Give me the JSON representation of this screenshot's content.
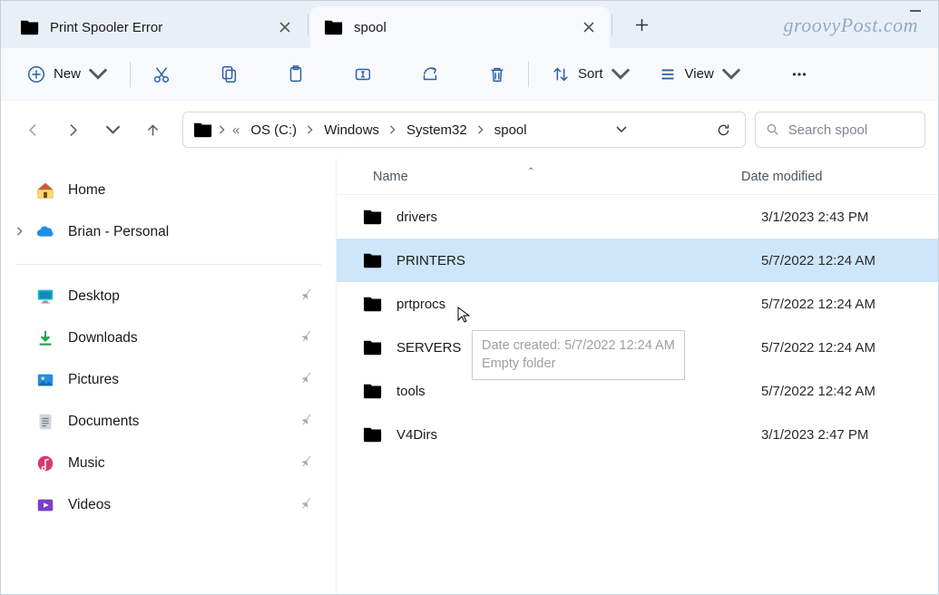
{
  "tabs": [
    {
      "label": "Print Spooler Error",
      "active": false
    },
    {
      "label": "spool",
      "active": true
    }
  ],
  "watermark": "groovyPost.com",
  "toolbar": {
    "new_label": "New",
    "sort_label": "Sort",
    "view_label": "View"
  },
  "breadcrumb": {
    "segments": [
      "OS (C:)",
      "Windows",
      "System32",
      "spool"
    ]
  },
  "search": {
    "placeholder": "Search spool"
  },
  "sidebar": {
    "home": "Home",
    "onedrive": "Brian - Personal",
    "quick": [
      {
        "label": "Desktop"
      },
      {
        "label": "Downloads"
      },
      {
        "label": "Pictures"
      },
      {
        "label": "Documents"
      },
      {
        "label": "Music"
      },
      {
        "label": "Videos"
      }
    ]
  },
  "columns": {
    "name": "Name",
    "date": "Date modified"
  },
  "files": [
    {
      "name": "drivers",
      "date": "3/1/2023 2:43 PM",
      "selected": false
    },
    {
      "name": "PRINTERS",
      "date": "5/7/2022 12:24 AM",
      "selected": true
    },
    {
      "name": "prtprocs",
      "date": "5/7/2022 12:24 AM",
      "selected": false
    },
    {
      "name": "SERVERS",
      "date": "5/7/2022 12:24 AM",
      "selected": false
    },
    {
      "name": "tools",
      "date": "5/7/2022 12:42 AM",
      "selected": false
    },
    {
      "name": "V4Dirs",
      "date": "3/1/2023 2:47 PM",
      "selected": false
    }
  ],
  "tooltip": {
    "line1": "Date created: 5/7/2022 12:24 AM",
    "line2": "Empty folder"
  }
}
